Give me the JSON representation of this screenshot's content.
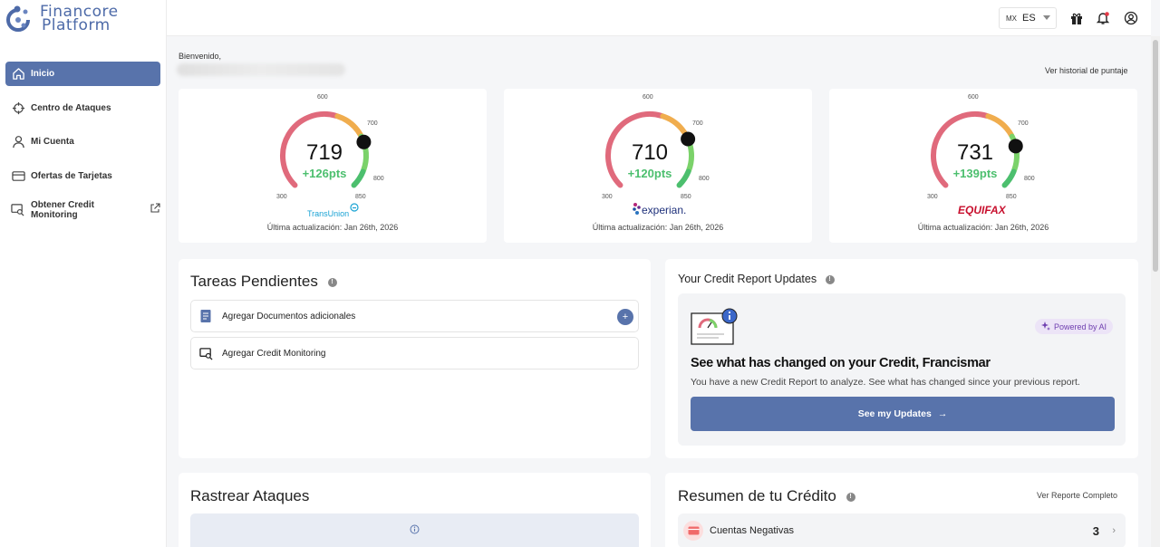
{
  "brand": {
    "line1": "Financore",
    "line2": "Platform"
  },
  "sidebar": {
    "items": [
      {
        "label": "Inicio",
        "icon": "home-icon",
        "active": true
      },
      {
        "label": "Centro de Ataques",
        "icon": "crosshair-icon"
      },
      {
        "label": "Mi Cuenta",
        "icon": "user-icon"
      },
      {
        "label": "Ofertas de Tarjetas",
        "icon": "credit-card-icon"
      },
      {
        "label": "Obtener Credit Monitoring",
        "icon": "monitor-search-icon",
        "external": "external-link-icon"
      }
    ]
  },
  "topbar": {
    "country": "MX",
    "language": "ES",
    "icons": [
      "gift-icon",
      "bell-icon",
      "account-circle-icon"
    ]
  },
  "welcome": {
    "greeting": "Bienvenido,",
    "history_link": "Ver historial de puntaje"
  },
  "gauges": [
    {
      "bureau": "TransUnion",
      "score": 719,
      "score_text": "719",
      "change": "+126pts",
      "updated": "Última actualización: Jan 26th, 2026",
      "ticks": [
        "300",
        "600",
        "700",
        "800",
        "850"
      ],
      "color": "#1aa3d4"
    },
    {
      "bureau": "experian.",
      "score": 710,
      "score_text": "710",
      "change": "+120pts",
      "updated": "Última actualización: Jan 26th, 2026",
      "ticks": [
        "300",
        "600",
        "700",
        "800",
        "850"
      ],
      "color": "#1d2f7a"
    },
    {
      "bureau": "EQUIFAX",
      "score": 731,
      "score_text": "731",
      "change": "+139pts",
      "updated": "Última actualización: Jan 26th, 2026",
      "ticks": [
        "300",
        "600",
        "700",
        "800",
        "850"
      ],
      "color": "#c8102e"
    }
  ],
  "tasks": {
    "title": "Tareas Pendientes",
    "items": [
      {
        "label": "Agregar Documentos adicionales",
        "icon": "document-icon"
      },
      {
        "label": "Agregar Credit Monitoring",
        "icon": "monitor-search-icon"
      }
    ],
    "add_label": "+"
  },
  "updates": {
    "title": "Your Credit Report Updates",
    "badge": "Powered by AI",
    "headline": "See what has changed on your Credit, Francismar",
    "body": "You have a new Credit Report to analyze. See what has changed since your previous report.",
    "button": "See my Updates",
    "arrow": "→"
  },
  "track": {
    "title": "Rastrear Ataques"
  },
  "summary": {
    "title": "Resumen de tu Crédito",
    "link": "Ver Reporte Completo",
    "rows": [
      {
        "label": "Cuentas Negativas",
        "count": "3",
        "chevron": "›"
      }
    ]
  },
  "colors": {
    "accent": "#5873ab",
    "positive": "#4cbf6e",
    "gauge_red": "#e06a7c",
    "gauge_orange": "#f0ad4e",
    "gauge_green": "#7bd26a"
  }
}
